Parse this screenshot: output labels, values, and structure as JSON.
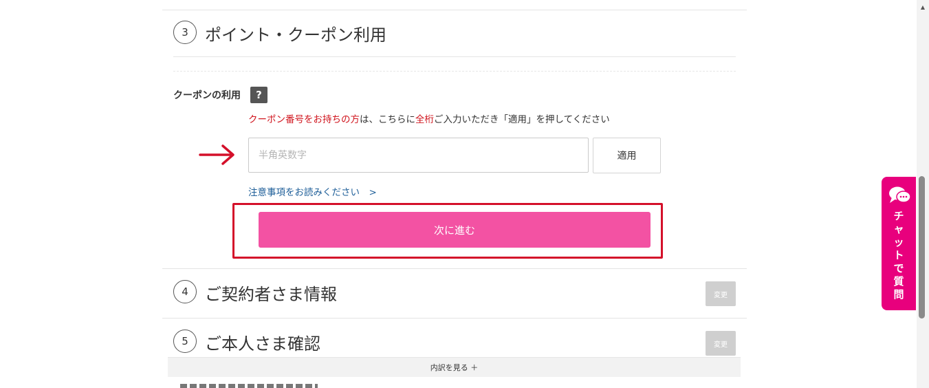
{
  "steps": [
    {
      "number": "3",
      "title": "ポイント・クーポン利用"
    },
    {
      "number": "4",
      "title": "ご契約者さま情報",
      "change_label": "変更"
    },
    {
      "number": "5",
      "title": "ご本人さま確認",
      "change_label": "変更"
    }
  ],
  "coupon": {
    "label": "クーポンの利用",
    "help_icon": "?",
    "notice_red1": "クーポン番号をお持ちの方",
    "notice_text1": "は、こちらに",
    "notice_red2": "全桁",
    "notice_text2": "ご入力いただき「適用」を押してください",
    "input_placeholder": "半角英数字",
    "input_value": "",
    "apply_label": "適用",
    "notes_link": "注意事項をお読みください　>",
    "next_label": "次に進む"
  },
  "breakdown": {
    "label": "内訳を見る ＋"
  },
  "chat": {
    "icon": "chat-bubble-icon",
    "label_chars": [
      "チ",
      "ャ",
      "ッ",
      "ト",
      "で",
      "質",
      "問"
    ]
  },
  "colors": {
    "accent_pink": "#f352a3",
    "chat_pink": "#e8007d",
    "annotation_red": "#d4102a",
    "notice_red": "#d0141d",
    "link_blue": "#1f5f99"
  }
}
